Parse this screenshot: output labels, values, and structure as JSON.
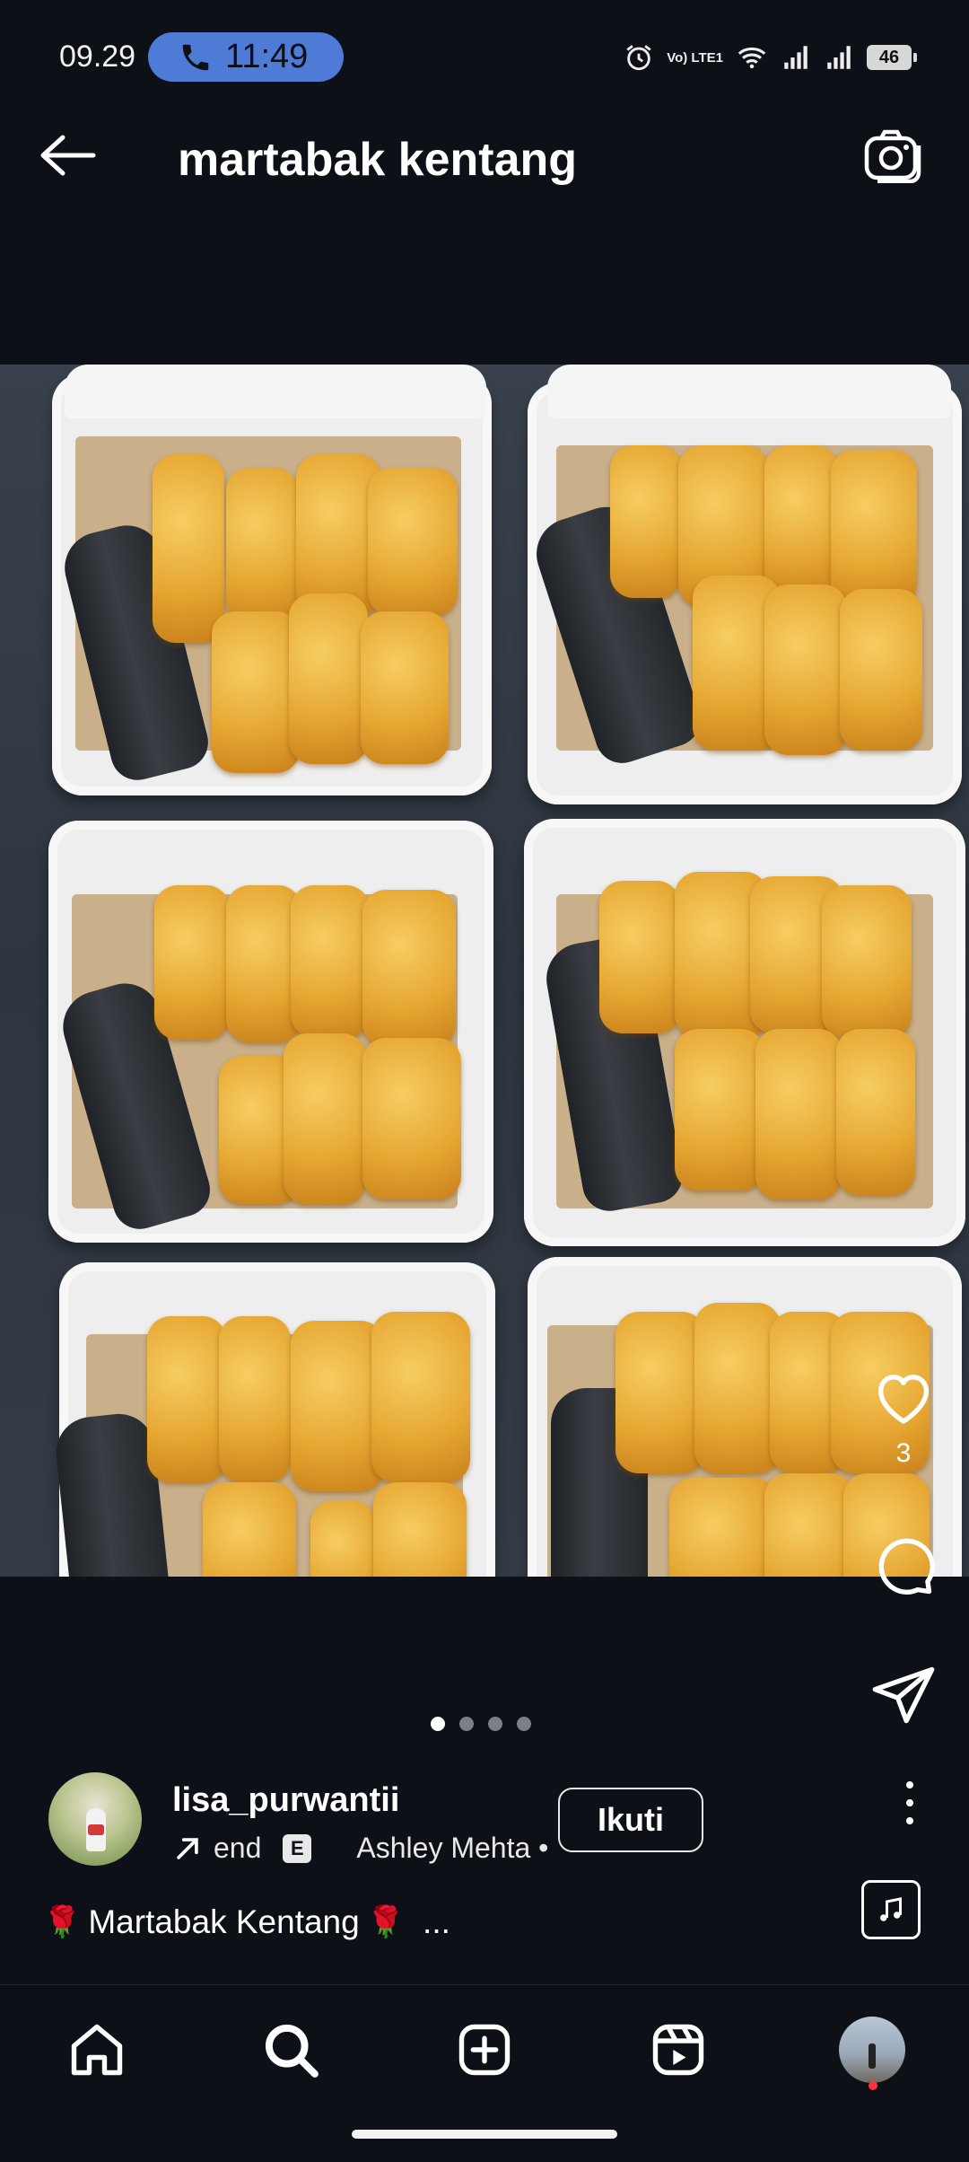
{
  "status_bar": {
    "time": "09.29",
    "call_time": "11:49",
    "network_badge": "Vo) LTE1",
    "battery": "46",
    "icons": [
      "phone-icon",
      "alarm-icon",
      "wifi-icon",
      "signal-icon",
      "signal-icon",
      "battery-icon"
    ]
  },
  "header": {
    "title": "martabak kentang",
    "icons": [
      "back-arrow-icon",
      "camera-icon"
    ]
  },
  "post": {
    "like_count": "3",
    "carousel": {
      "total": 4,
      "active": 1
    },
    "author": {
      "username": "lisa_purwantii",
      "audio_title": "end",
      "explicit_badge": "E",
      "audio_artist": "Ashley Mehta •",
      "follow_label": "Ikuti"
    },
    "caption": {
      "text": "Martabak Kentang",
      "more": "..."
    },
    "action_icons": [
      "heart-icon",
      "comment-icon",
      "share-icon",
      "more-icon",
      "music-icon"
    ]
  },
  "bottom_nav": {
    "items": [
      "home-icon",
      "search-icon",
      "create-icon",
      "reels-icon",
      "profile-avatar"
    ]
  },
  "colors": {
    "background": "#0d1117",
    "call_pill": "#4d7bd6",
    "notification": "#ff3040"
  }
}
